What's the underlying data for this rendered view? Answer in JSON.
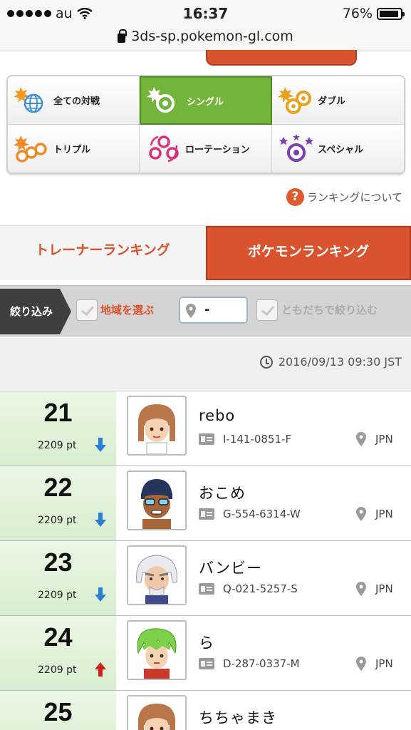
{
  "status_bar": {
    "carrier": "au",
    "time": "16:37",
    "battery": "76%"
  },
  "browser": {
    "url": "3ds-sp.pokemon-gl.com"
  },
  "battle_types": [
    {
      "label": "全ての対戦",
      "icon": "globe-icon",
      "active": false
    },
    {
      "label": "シングル",
      "icon": "single-ball-icon",
      "active": true
    },
    {
      "label": "ダブル",
      "icon": "double-ball-icon",
      "active": false
    },
    {
      "label": "トリプル",
      "icon": "triple-ball-icon",
      "active": false
    },
    {
      "label": "ローテーション",
      "icon": "rotation-ball-icon",
      "active": false
    },
    {
      "label": "スペシャル",
      "icon": "special-ball-icon",
      "active": false
    }
  ],
  "help": {
    "icon_text": "?",
    "label": "ランキングについて"
  },
  "tabs": {
    "trainer": "トレーナーランキング",
    "pokemon": "ポケモンランキング"
  },
  "filter": {
    "label": "絞り込み",
    "region_label": "地域を選ぶ",
    "region_value": "-",
    "friends_label": "ともだちで絞り込む"
  },
  "updated": "2016/09/13 09:30 JST",
  "colors": {
    "accent_orange": "#d9532f",
    "active_green": "#73b53b",
    "rank_bg": "#e2f2db",
    "arrow_down": "#2a7fd4",
    "arrow_up": "#d0201a"
  },
  "rankings": [
    {
      "rank": "21",
      "points": "2209 pt",
      "trend": "down",
      "name": "rebo",
      "trainer_id": "I-141-0851-F",
      "country": "JPN",
      "avatar": "brown-hair-girl"
    },
    {
      "rank": "22",
      "points": "2209 pt",
      "trend": "down",
      "name": "おこめ",
      "trainer_id": "G-554-6314-W",
      "country": "JPN",
      "avatar": "swimmer-goggles"
    },
    {
      "rank": "23",
      "points": "2209 pt",
      "trend": "down",
      "name": "バンビー",
      "trainer_id": "Q-021-5257-S",
      "country": "JPN",
      "avatar": "old-man"
    },
    {
      "rank": "24",
      "points": "2209 pt",
      "trend": "up",
      "name": "ら",
      "trainer_id": "D-287-0337-M",
      "country": "JPN",
      "avatar": "green-hair-boy"
    },
    {
      "rank": "25",
      "points": "",
      "trend": "",
      "name": "ちちゃまき",
      "trainer_id": "",
      "country": "",
      "avatar": "brown-hair-girl"
    }
  ]
}
